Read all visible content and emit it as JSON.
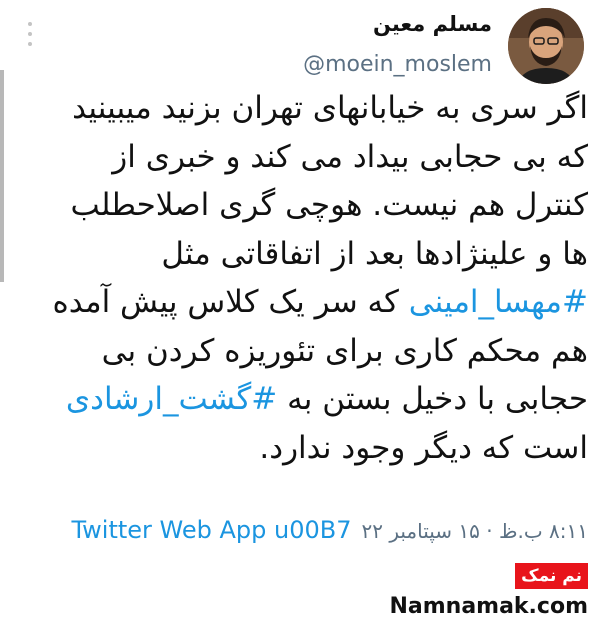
{
  "tweet": {
    "author": {
      "display_name": "مسلم معین",
      "handle": "@moein_moslem"
    },
    "lines": [
      {
        "text": "اگر سری به خیابانهای تهران بزنید میبینید"
      },
      {
        "text": "که بی حجابی بیداد می کند و خبری از"
      },
      {
        "text": "کنترل هم نیست. هوچی گری اصلاحطلب"
      },
      {
        "text": "ها و علینژادها بعد از اتفاقاتی مثل"
      },
      {
        "hashtag": "#مهسا_امینی",
        "text": " که سر یک کلاس پیش آمده"
      },
      {
        "text": "هم محکم کاری برای تئوریزه کردن بی"
      },
      {
        "text": "حجابی با دخیل بستن به ",
        "hashtag": "#گشت_ارشادی"
      },
      {
        "text": "است که دیگر وجود ندارد."
      }
    ],
    "timestamp": "۸:۱۱ ب.ظ · ۱۵ سپتامبر ۲۲",
    "source": "Twitter Web App u00B7"
  },
  "watermark": {
    "badge": "نم نمک",
    "site": "Namnamak.com"
  },
  "colors": {
    "link": "#1b95e0",
    "secondary_text": "#5b7083",
    "watermark_badge": "#e8141b"
  },
  "icons": {
    "more_menu": "vertical-ellipsis-icon",
    "avatar": "profile-photo"
  }
}
